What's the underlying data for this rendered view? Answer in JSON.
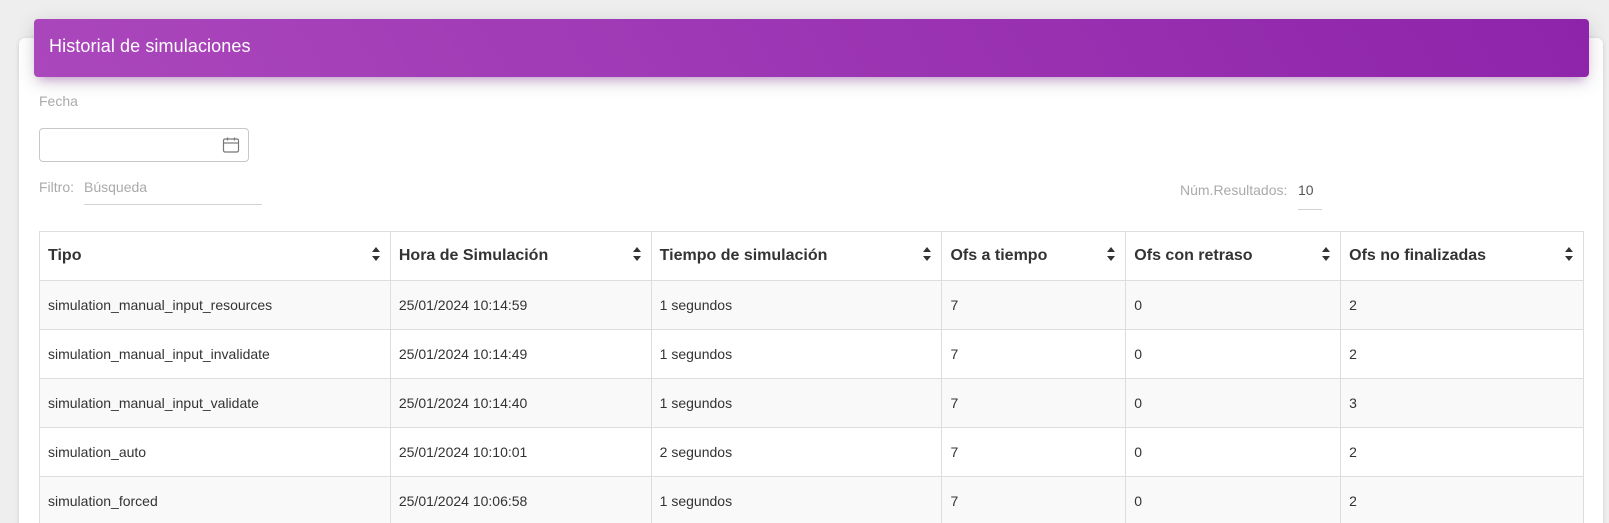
{
  "header": {
    "title": "Historial de simulaciones"
  },
  "filters": {
    "fecha_label": "Fecha",
    "fecha_value": "",
    "filtro_label": "Filtro:",
    "search_placeholder": "Búsqueda",
    "search_value": "",
    "num_resultados_label": "Núm.Resultados:",
    "num_resultados_value": "10"
  },
  "table": {
    "columns": [
      "Tipo",
      "Hora de Simulación",
      "Tiempo de simulación",
      "Ofs a tiempo",
      "Ofs con retraso",
      "Ofs no finalizadas"
    ],
    "rows": [
      [
        "simulation_manual_input_resources",
        "25/01/2024 10:14:59",
        "1 segundos",
        "7",
        "0",
        "2"
      ],
      [
        "simulation_manual_input_invalidate",
        "25/01/2024 10:14:49",
        "1 segundos",
        "7",
        "0",
        "2"
      ],
      [
        "simulation_manual_input_validate",
        "25/01/2024 10:14:40",
        "1 segundos",
        "7",
        "0",
        "3"
      ],
      [
        "simulation_auto",
        "25/01/2024 10:10:01",
        "2 segundos",
        "7",
        "0",
        "2"
      ],
      [
        "simulation_forced",
        "25/01/2024 10:06:58",
        "1 segundos",
        "7",
        "0",
        "2"
      ]
    ]
  },
  "icons": {
    "calendar": "calendar-icon",
    "sort": "sort-icon"
  },
  "colors": {
    "header_start": "#ab47bc",
    "header_end": "#8e24aa"
  }
}
